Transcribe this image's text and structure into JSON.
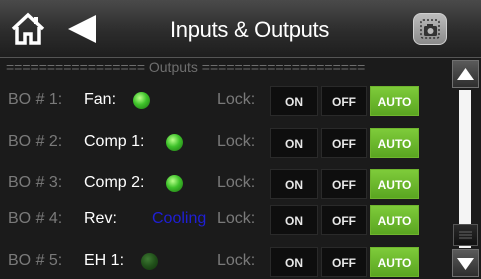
{
  "header": {
    "title": "Inputs & Outputs",
    "home_icon": "home-icon",
    "back_icon": "back-arrow-icon",
    "camera_icon": "camera-icon"
  },
  "section": {
    "header_text": "================= Outputs ===================="
  },
  "lock_label": "Lock:",
  "buttons": {
    "on": "ON",
    "off": "OFF",
    "auto": "AUTO"
  },
  "colors": {
    "led_on": "#3ec22a",
    "led_off": "#21501a",
    "auto_active": "#6cbb2c",
    "state_text": "#1f1fd6"
  },
  "rows": [
    {
      "bo": "BO # 1:",
      "name": "Fan:",
      "led": "on",
      "state_text": "",
      "selected": "AUTO"
    },
    {
      "bo": "BO # 2:",
      "name": "Comp 1:",
      "led": "on",
      "state_text": "",
      "selected": "AUTO"
    },
    {
      "bo": "BO # 3:",
      "name": "Comp 2:",
      "led": "on",
      "state_text": "",
      "selected": "AUTO"
    },
    {
      "bo": "BO # 4:",
      "name": "Rev:",
      "led": "none",
      "state_text": "Cooling",
      "selected": "AUTO"
    },
    {
      "bo": "BO # 5:",
      "name": "EH 1:",
      "led": "off",
      "state_text": "",
      "selected": "AUTO"
    }
  ]
}
